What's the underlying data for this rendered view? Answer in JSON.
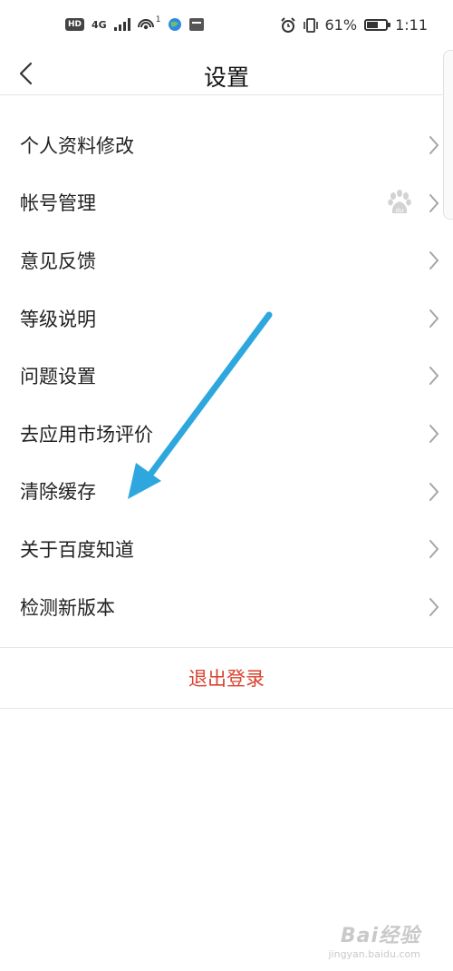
{
  "status_bar": {
    "hd": "HD",
    "network": "4G",
    "hotspot_badge": "1",
    "battery_percent": "61%",
    "battery_level": 0.61,
    "time": "1:11"
  },
  "header": {
    "title": "设置"
  },
  "menu": {
    "items": [
      {
        "label": "个人资料修改"
      },
      {
        "label": "帐号管理"
      },
      {
        "label": "意见反馈"
      },
      {
        "label": "等级说明"
      },
      {
        "label": "问题设置"
      },
      {
        "label": "去应用市场评价"
      },
      {
        "label": "清除缓存"
      },
      {
        "label": "关于百度知道"
      },
      {
        "label": "检测新版本"
      }
    ]
  },
  "logout": {
    "label": "退出登录"
  },
  "icons": {
    "back": "chevron-left-icon",
    "row_arrow": "chevron-right-icon",
    "baidu": "baidu-paw-icon",
    "annotation": "blue-arrow"
  },
  "colors": {
    "logout_text": "#d9432f",
    "annotation_arrow": "#2ea7df",
    "divider": "#e6e6e6"
  },
  "watermark": {
    "main": "Bai经验",
    "sub": "jingyan.baidu.com"
  }
}
